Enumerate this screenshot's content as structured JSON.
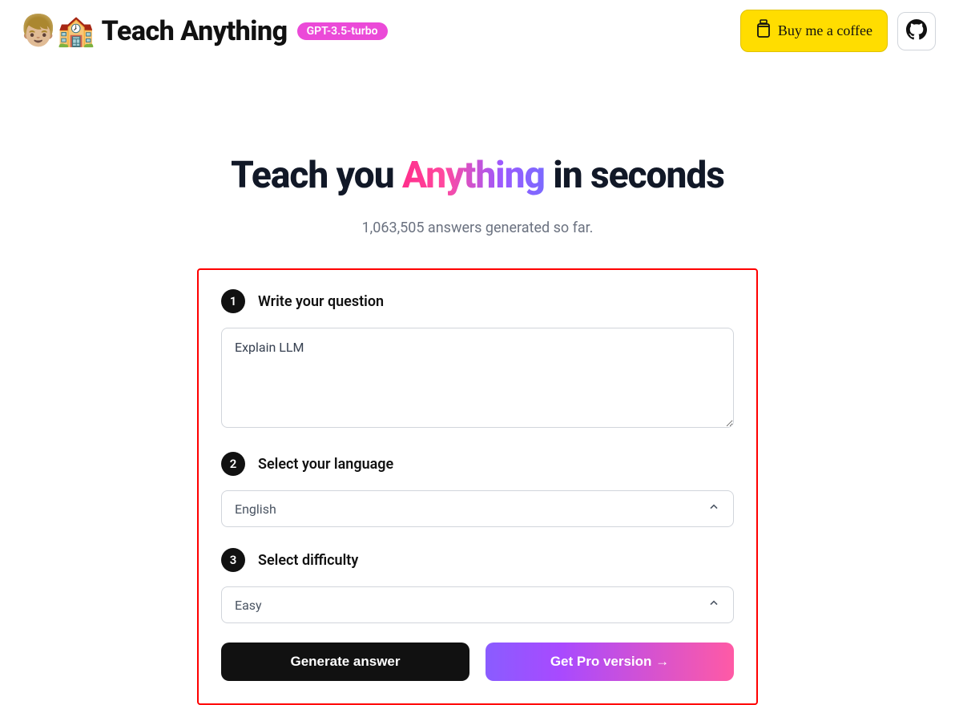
{
  "header": {
    "logo_emoji": "👦🏼🏫",
    "logo_text": "Teach Anything",
    "badge": "GPT-3.5-turbo",
    "bmc_label": "Buy me a coffee"
  },
  "hero": {
    "prefix": "Teach you ",
    "highlight": "Anything",
    "suffix": " in seconds"
  },
  "subtext": "1,063,505 answers generated so far.",
  "form": {
    "step1_num": "1",
    "step1_label": "Write your question",
    "question_value": "Explain LLM",
    "step2_num": "2",
    "step2_label": "Select your language",
    "language_value": "English",
    "step3_num": "3",
    "step3_label": "Select difficulty",
    "difficulty_value": "Easy",
    "generate_label": "Generate answer",
    "pro_label": "Get Pro version →"
  }
}
